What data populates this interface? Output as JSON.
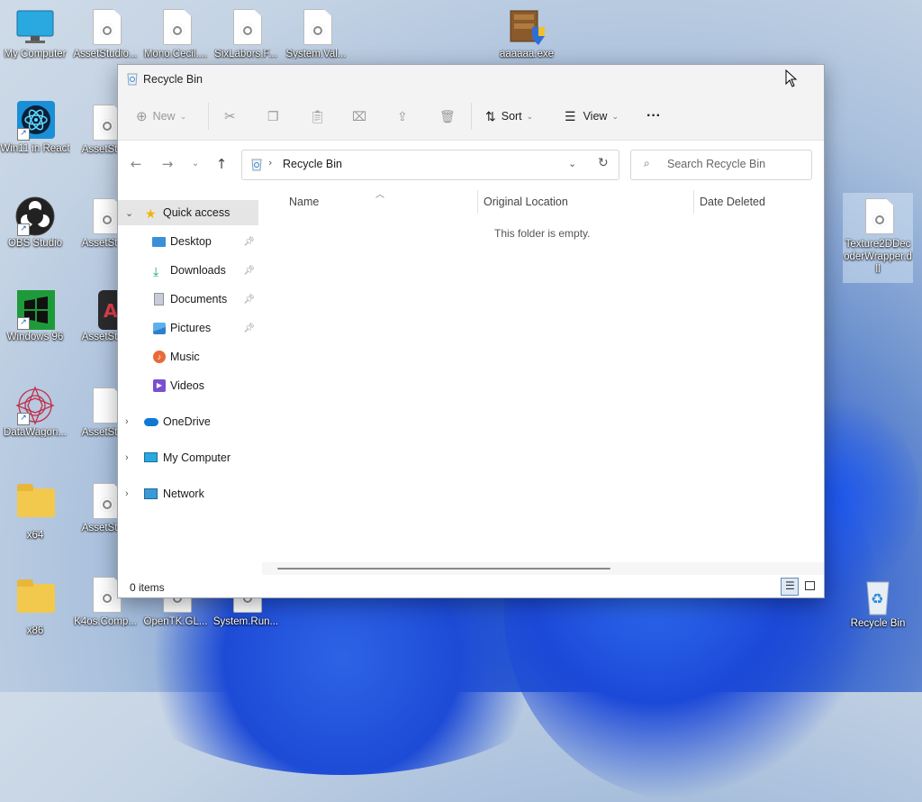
{
  "desktop": {
    "icons_left": [
      {
        "label": "My Computer"
      },
      {
        "label": "Win11 in React"
      },
      {
        "label": "OBS Studio"
      },
      {
        "label": "Windows 96"
      },
      {
        "label": "DataWagon..."
      },
      {
        "label": "x64"
      },
      {
        "label": "x86"
      }
    ],
    "icons_col2": [
      {
        "label": "AssetStudio..."
      },
      {
        "label": "AssetStud"
      },
      {
        "label": "AssetStud"
      },
      {
        "label": "AssetStud"
      },
      {
        "label": "AssetStud"
      },
      {
        "label": "AssetStud"
      },
      {
        "label": "K4os.Comp..."
      }
    ],
    "icons_top": [
      {
        "label": "Mono.Cecil...."
      },
      {
        "label": "SixLabors.F..."
      },
      {
        "label": "System.Val..."
      },
      {
        "label": "aaaaaa.exe"
      }
    ],
    "icons_bottom": [
      {
        "label": "OpenTK.GL..."
      },
      {
        "label": "System.Run..."
      }
    ],
    "icon_right_selected": {
      "label": "Texture2DDecoderWrapper.dll"
    },
    "recycle_bin": {
      "label": "Recycle Bin"
    }
  },
  "window": {
    "title": "Recycle Bin",
    "toolbar": {
      "new_label": "New",
      "sort_label": "Sort",
      "view_label": "View",
      "more_label": "···"
    },
    "address": {
      "path": "Recycle Bin",
      "search_placeholder": "Search Recycle Bin"
    },
    "nav": [
      {
        "label": "Quick access"
      },
      {
        "label": "Desktop"
      },
      {
        "label": "Downloads"
      },
      {
        "label": "Documents"
      },
      {
        "label": "Pictures"
      },
      {
        "label": "Music"
      },
      {
        "label": "Videos"
      },
      {
        "label": "OneDrive"
      },
      {
        "label": "My Computer"
      },
      {
        "label": "Network"
      }
    ],
    "columns": [
      "Name",
      "Original Location",
      "Date Deleted"
    ],
    "empty_message": "This folder is empty.",
    "status": {
      "item_count": "0 items"
    }
  },
  "colors": {
    "accent": "#0067c0",
    "folder": "#f2c94c"
  }
}
